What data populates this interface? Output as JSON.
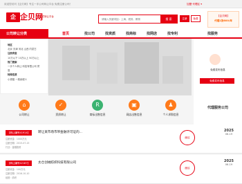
{
  "topbar": {
    "text": "欢迎您访问【企贝网】专注一手公司转让平台 免费注册公司！",
    "right": "加盟·代理区 ▾"
  },
  "header": {
    "logo": "企贝网",
    "logo_mark": "企",
    "slogan": "一站式转让平台"
  },
  "search": {
    "placeholder": "请输入关键词如：上海、税务、教育",
    "button": "搜 索"
  },
  "header_buttons": {
    "login": "注册",
    "register": "免费"
  },
  "promo": {
    "line1": "【企贝网】",
    "line2": "代理1张600/年"
  },
  "nav": {
    "category": "公司转让分类",
    "items": [
      "首页",
      "找公司",
      "找资质",
      "找商标",
      "找网店",
      "找专利"
    ],
    "service": "找服务"
  },
  "dropdown": {
    "section1": "地区",
    "regions": "北京 天津 河北 山西 内蒙古",
    "section2": "注册资金",
    "capitals": "10万以下 10万以上 50万以上",
    "section3": "热门搜索",
    "hot": "一手个人转让 科技有限公司 贸易",
    "section4": "特殊性质",
    "special": "小规模 一般纳税人"
  },
  "right_panel": {
    "title": "免费发布信息",
    "button": "免费发布信息"
  },
  "services": [
    {
      "label": "公司转让",
      "icon": "building-icon",
      "glyph": "⌂"
    },
    {
      "label": "资质转让",
      "icon": "certificate-icon",
      "glyph": "✓"
    },
    {
      "label": "商标出售信息",
      "icon": "trademark-icon",
      "glyph": "R"
    },
    {
      "label": "网店出售信息",
      "icon": "shop-icon",
      "glyph": "▣"
    },
    {
      "label": "个人求购信息",
      "icon": "person-icon",
      "glyph": "♟"
    }
  ],
  "agents_title": "代理服务公司",
  "listings": [
    {
      "code": "【转让编号41914】",
      "title": "转让某市场市带金融许可证的...",
      "capital": "注册资金：1000万元",
      "date_line": "注册日期：2015-07-15",
      "scope": "行业：金融投资",
      "price": "面议",
      "year": "2025",
      "md": "06-19"
    },
    {
      "code": "【转让编号42187】",
      "title": "太仓创绒纺织科技有限公司",
      "capital": "注册资金：100万元",
      "date_line": "注册日期：2016-10-10",
      "scope": "经营：纺织",
      "price": "面议",
      "year": "2025",
      "md": "06-19"
    }
  ],
  "colors": {
    "brand": "#e60012",
    "accent": "#ff6600"
  }
}
